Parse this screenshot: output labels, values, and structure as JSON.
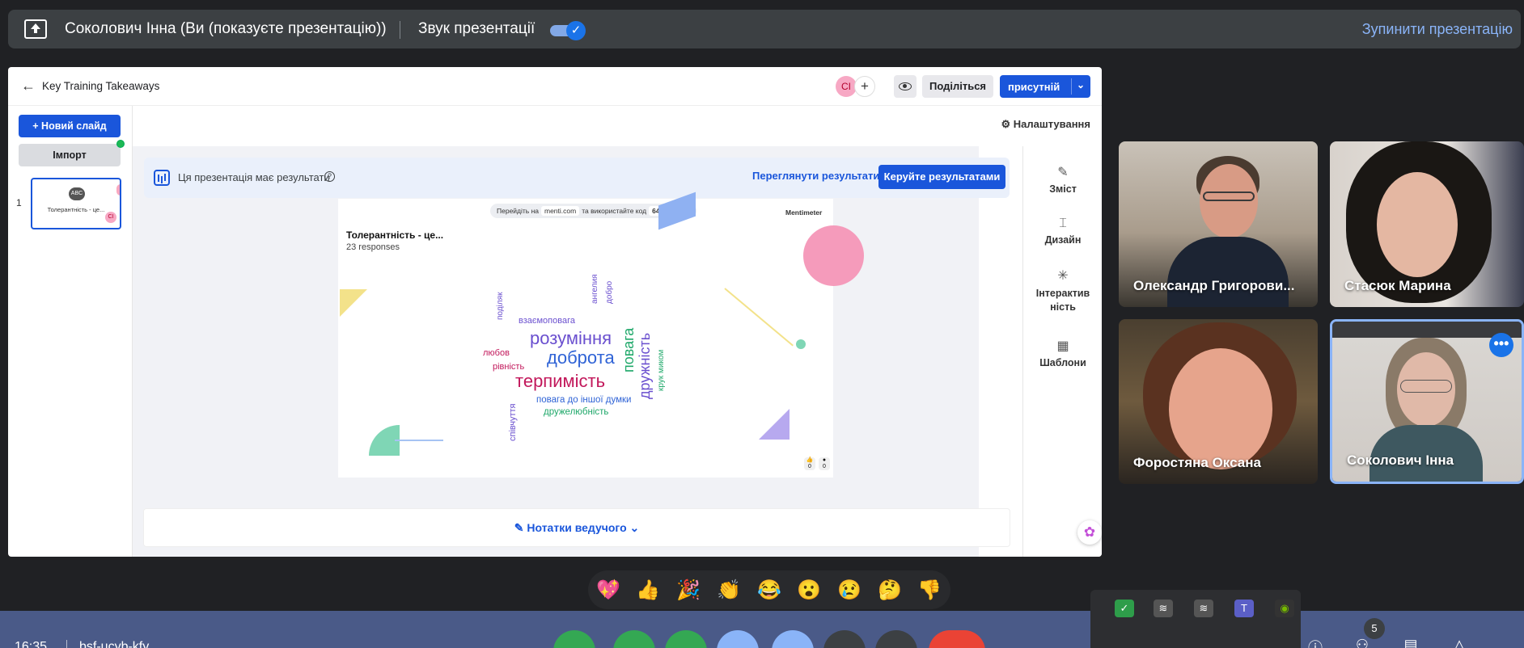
{
  "topbar": {
    "title": "Соколович Інна (Ви (показуєте презентацію))",
    "sound_label": "Звук презентації",
    "sound_toggle_on": true,
    "stop_label": "Зупинити презентацію"
  },
  "menti": {
    "title": "Key Training Takeaways",
    "avatar_initials": "CI",
    "share_label": "Поділіться",
    "present_label": "присутній",
    "new_slide_label": "+ Новий слайд",
    "import_label": "Імпорт",
    "slide_number": "1",
    "thumb_title": "Толерантність - це...",
    "thumb_icon": "ABC",
    "settings_label": "Налаштування",
    "banner_text": "Ця презентація має результати",
    "view_results": "Переглянути результати",
    "manage_results": "Керуйте результатами",
    "slide": {
      "go_prefix": "Перейдіть на",
      "site": "menti.com",
      "go_middle": "та використайте код",
      "code": "6420 7727",
      "brand": "Mentimeter",
      "question": "Толерантність - це...",
      "responses": "23 responses",
      "counter_a": "0",
      "counter_b": "0"
    },
    "words": [
      {
        "text": "розуміння",
        "color": "#6a4fcf"
      },
      {
        "text": "доброта",
        "color": "#2f63d6"
      },
      {
        "text": "терпимість",
        "color": "#c2185b"
      },
      {
        "text": "повага",
        "color": "#1fa86a"
      },
      {
        "text": "дружність",
        "color": "#6a4fcf"
      },
      {
        "text": "взаємоповага",
        "color": "#6a4fcf"
      },
      {
        "text": "любов",
        "color": "#c2185b"
      },
      {
        "text": "рівність",
        "color": "#c2185b"
      },
      {
        "text": "повага до іншої думки",
        "color": "#2f63d6"
      },
      {
        "text": "дружелюбність",
        "color": "#1fa86a"
      },
      {
        "text": "співчуття",
        "color": "#6a4fcf"
      },
      {
        "text": "поділяк",
        "color": "#6a4fcf"
      },
      {
        "text": "ангелия",
        "color": "#6a4fcf"
      },
      {
        "text": "добро",
        "color": "#6a4fcf"
      },
      {
        "text": "крук миком",
        "color": "#1fa86a"
      }
    ],
    "tools": [
      {
        "label": "Зміст",
        "icon": "pencil-icon"
      },
      {
        "label": "Дизайн",
        "icon": "brush-icon"
      },
      {
        "label": "Інтерактив ність",
        "icon": "interactive-icon"
      },
      {
        "label": "Шаблони",
        "icon": "templates-icon"
      }
    ],
    "notes_label": "Нотатки ведучого"
  },
  "participants": [
    {
      "name": "Олександр Григорови..."
    },
    {
      "name": "Стасюк Марина"
    },
    {
      "name": "Форостяна Оксана"
    },
    {
      "name": "Соколович Інна"
    }
  ],
  "reactions": [
    "💖",
    "👍",
    "🎉",
    "👏",
    "😂",
    "😮",
    "😢",
    "🤔",
    "👎"
  ],
  "bottombar": {
    "clock": "16:35",
    "meeting_id": "bsf-ucyb-kfy",
    "people_count": "5"
  }
}
